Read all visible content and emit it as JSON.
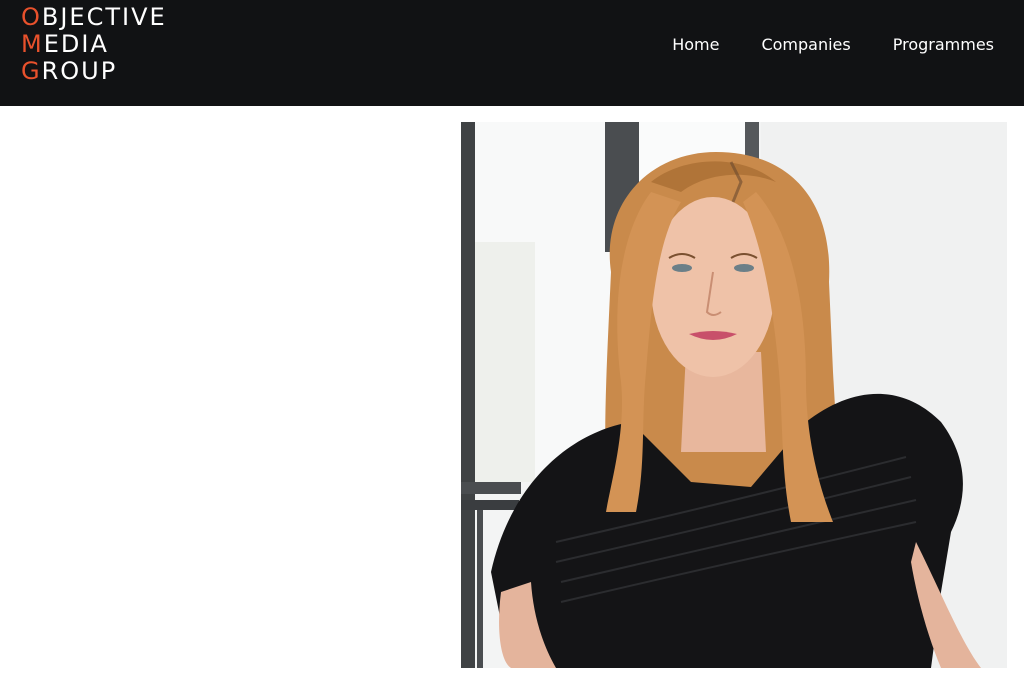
{
  "header": {
    "logo": {
      "lines": [
        {
          "initial": "O",
          "rest": "BJECTIVE"
        },
        {
          "initial": "M",
          "rest": "EDIA"
        },
        {
          "initial": "G",
          "rest": "ROUP"
        }
      ]
    },
    "nav": {
      "items": [
        {
          "label": "Home"
        },
        {
          "label": "Companies"
        },
        {
          "label": "Programmes"
        }
      ]
    }
  },
  "colors": {
    "header_bg": "#111214",
    "logo_accent": "#e8512c",
    "page_bg": "#ffffff"
  }
}
